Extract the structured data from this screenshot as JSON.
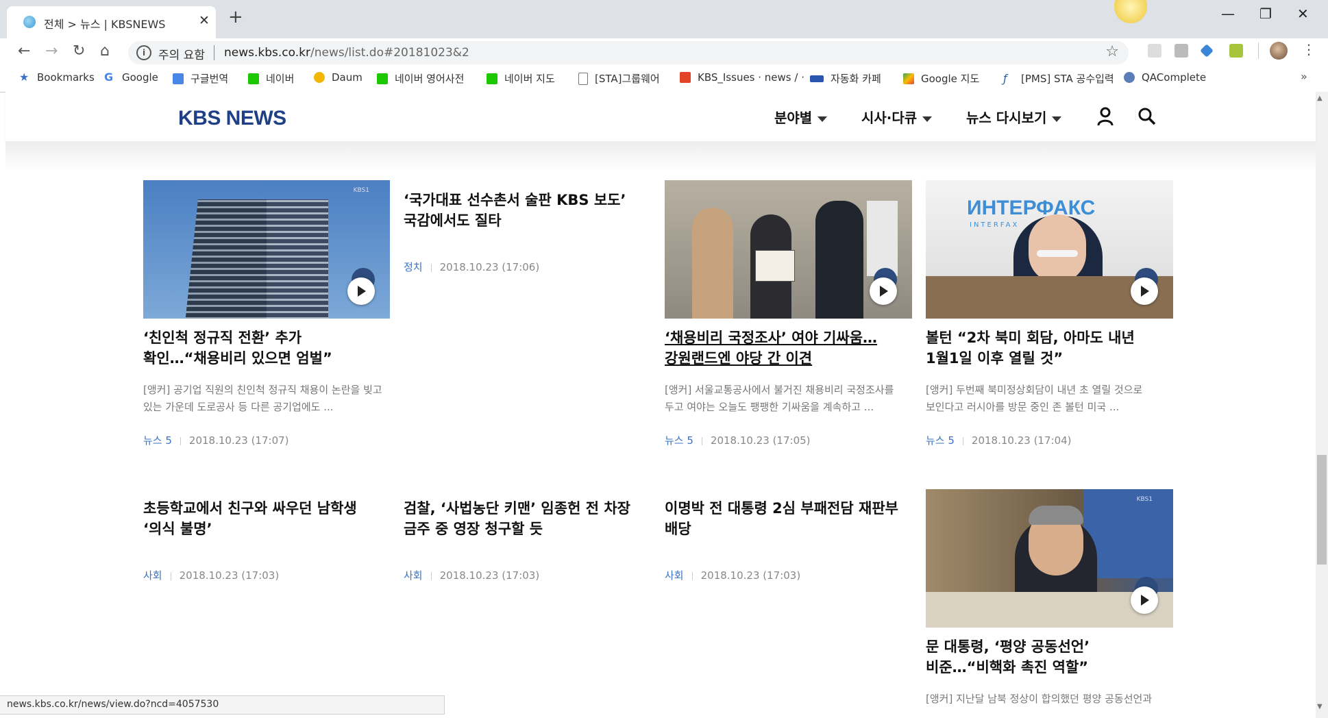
{
  "browser": {
    "tab_title": "전체 > 뉴스 | KBSNEWS",
    "security_warning": "주의 요함",
    "url_domain": "news.kbs.co.kr",
    "url_path": "/news/list.do#20181023&2",
    "status_url": "news.kbs.co.kr/news/view.do?ncd=4057530"
  },
  "bookmarks": [
    {
      "label": "Bookmarks",
      "icon": "star-icon"
    },
    {
      "label": "Google",
      "icon": "google-icon"
    },
    {
      "label": "구글번역",
      "icon": "translate-icon"
    },
    {
      "label": "네이버",
      "icon": "naver-icon"
    },
    {
      "label": "Daum",
      "icon": "daum-icon"
    },
    {
      "label": "네이버 영어사전",
      "icon": "dictionary-icon"
    },
    {
      "label": "네이버 지도",
      "icon": "naver-icon"
    },
    {
      "label": "[STA]그룹웨어",
      "icon": "page-icon"
    },
    {
      "label": "KBS_Issues · news / ·",
      "icon": "gitlab-icon"
    },
    {
      "label": "자동화 카페",
      "icon": "cafe-icon"
    },
    {
      "label": "Google 지도",
      "icon": "maps-icon"
    },
    {
      "label": "[PMS] STA 공수입력",
      "icon": "pms-icon"
    },
    {
      "label": "QAComplete",
      "icon": "qacomplete-icon"
    }
  ],
  "site": {
    "logo": "KBS NEWS",
    "menu": [
      "분야별",
      "시사·다큐",
      "뉴스 다시보기"
    ]
  },
  "articles": [
    {
      "headline1": "‘친인척 정규직 전환’ 추가",
      "headline2": "확인…“채용비리 있으면 엄벌”",
      "summary1": "[앵커] 공기업 직원의 친인척 정규직 채용이 논란을 빚고",
      "summary2": "있는 가운데 도로공사 등 다른 공기업에도 ...",
      "category": "뉴스 5",
      "date": "2018.10.23 (17:07)"
    },
    {
      "headline1": "‘국가대표 선수촌서 술판 KBS 보도’",
      "headline2": "국감에서도 질타",
      "category": "정치",
      "date": "2018.10.23 (17:06)"
    },
    {
      "headline1": "‘채용비리 국정조사’ 여야 기싸움…",
      "headline2": "강원랜드엔 야당 간 이견",
      "summary1": "[앵커] 서울교통공사에서 불거진 채용비리 국정조사를",
      "summary2": "두고 여야는 오늘도 팽팽한 기싸움을 계속하고 ...",
      "category": "뉴스 5",
      "date": "2018.10.23 (17:05)"
    },
    {
      "headline1": "볼턴 “2차 북미 회담, 아마도 내년",
      "headline2": "1월1일 이후 열릴 것”",
      "summary1": "[앵커] 두번째 북미정상회담이 내년 초 열릴 것으로",
      "summary2": "보인다고 러시아를 방문 중인 존 볼턴 미국 ...",
      "category": "뉴스 5",
      "date": "2018.10.23 (17:04)"
    },
    {
      "headline1": "초등학교에서 친구와 싸우던 남학생",
      "headline2": "‘의식 불명’",
      "category": "사회",
      "date": "2018.10.23 (17:03)"
    },
    {
      "headline1": "검찰, ‘사법농단 키맨’ 임종헌 전 차장",
      "headline2": "금주 중 영장 청구할 듯",
      "category": "사회",
      "date": "2018.10.23 (17:03)"
    },
    {
      "headline1": "이명박 전 대통령 2심 부패전담 재판부",
      "headline2": "배당",
      "category": "사회",
      "date": "2018.10.23 (17:03)"
    },
    {
      "headline1": "문 대통령, ‘평양 공동선언’",
      "headline2": "비준…“비핵화 촉진 역할”",
      "summary1": "[앵커] 지난달 남북 정상이 합의했던 평양 공동선언과"
    }
  ],
  "thumbnail_labels": {
    "kbs1": "KBS1",
    "interfax": "ИНТЕРФАКС",
    "interfax_small": "INTERFAX"
  }
}
